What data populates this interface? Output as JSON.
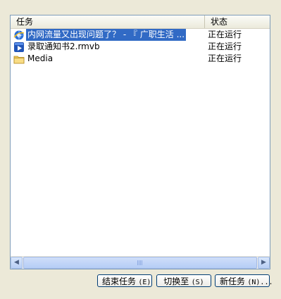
{
  "columns": {
    "task": "任务",
    "status": "状态"
  },
  "tasks": [
    {
      "name": "内网流量又出现问题了？ - 『 广职生活 ...",
      "status": "正在运行",
      "icon": "ie-icon",
      "selected": true
    },
    {
      "name": "录取通知书2.rmvb",
      "status": "正在运行",
      "icon": "media-player-icon",
      "selected": false
    },
    {
      "name": "Media",
      "status": "正在运行",
      "icon": "folder-icon",
      "selected": false
    }
  ],
  "buttons": {
    "end_task": "结束任务",
    "end_task_key": "(E)",
    "switch_to": "切换至",
    "switch_to_key": "(S)",
    "new_task": "新任务",
    "new_task_key": "(N)..."
  },
  "colors": {
    "selection": "#316ac5",
    "window_bg": "#ece9d8"
  }
}
